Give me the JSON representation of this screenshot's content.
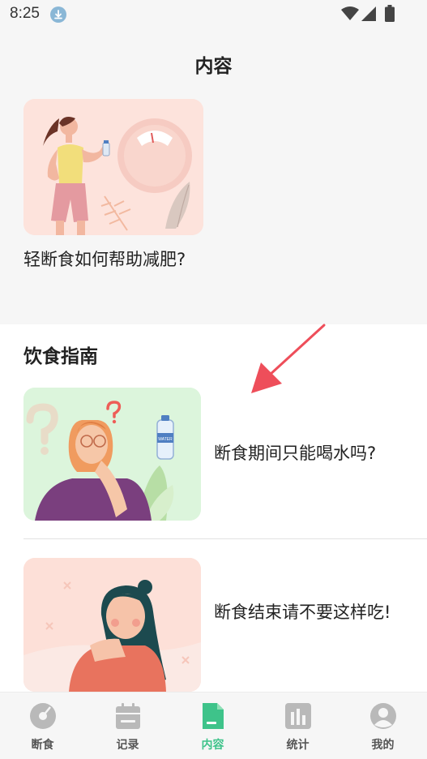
{
  "status_bar": {
    "time": "8:25"
  },
  "header": {
    "title": "内容"
  },
  "featured": {
    "title": "轻断食如何帮助减肥?",
    "bottle_label": "WATER"
  },
  "diet_guide": {
    "section_title": "饮食指南",
    "articles": [
      {
        "title": "断食期间只能喝水吗?",
        "thumb_bg": "#dcf5dc"
      },
      {
        "title": "断食结束请不要这样吃!",
        "thumb_bg": "#fde0d8"
      }
    ]
  },
  "tab_bar": {
    "tabs": [
      {
        "label": "断食",
        "icon": "fasting-disc-icon",
        "active": false
      },
      {
        "label": "记录",
        "icon": "calendar-icon",
        "active": false
      },
      {
        "label": "内容",
        "icon": "document-icon",
        "active": true
      },
      {
        "label": "统计",
        "icon": "bar-chart-icon",
        "active": false
      },
      {
        "label": "我的",
        "icon": "profile-icon",
        "active": false
      }
    ]
  },
  "colors": {
    "accent": "#3ec38a",
    "arrow": "#ee4e5a",
    "tab_inactive": "#b9b9b9"
  }
}
